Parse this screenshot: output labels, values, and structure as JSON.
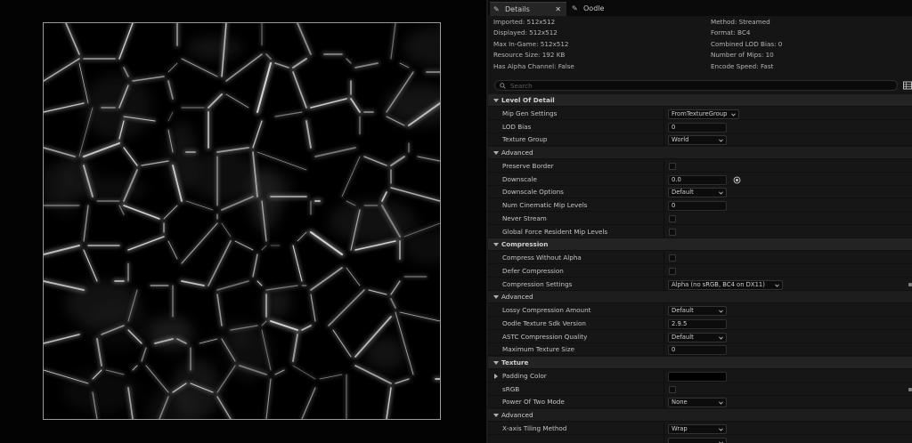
{
  "tabs": [
    {
      "label": "Details",
      "icon": "pencil-icon",
      "active": true
    },
    {
      "label": "Oodle",
      "icon": "pencil-icon",
      "active": false
    }
  ],
  "info": {
    "left": [
      "Imported: 512x512",
      "Displayed: 512x512",
      "Max In-Game: 512x512",
      "Resource Size: 192 KB",
      "Has Alpha Channel: False"
    ],
    "right": [
      "Method: Streamed",
      "Format: BC4",
      "Combined LOD Bias: 0",
      "Number of Mips: 10",
      "Encode Speed: Fast"
    ]
  },
  "search": {
    "placeholder": "Search"
  },
  "rows": [
    {
      "kind": "cat",
      "label": "Level Of Detail"
    },
    {
      "kind": "prop",
      "label": "Mip Gen Settings",
      "widget": "combo",
      "value": "FromTextureGroup"
    },
    {
      "kind": "prop",
      "label": "LOD Bias",
      "widget": "number",
      "value": "0"
    },
    {
      "kind": "prop",
      "label": "Texture Group",
      "widget": "combo",
      "value": "World"
    },
    {
      "kind": "sub",
      "label": "Advanced"
    },
    {
      "kind": "prop",
      "label": "Preserve Border",
      "widget": "check"
    },
    {
      "kind": "prop",
      "label": "Downscale",
      "widget": "number",
      "value": "0.0",
      "reset": true
    },
    {
      "kind": "prop",
      "label": "Downscale Options",
      "widget": "combo",
      "value": "Default"
    },
    {
      "kind": "prop",
      "label": "Num Cinematic Mip Levels",
      "widget": "number",
      "value": "0"
    },
    {
      "kind": "prop",
      "label": "Never Stream",
      "widget": "check"
    },
    {
      "kind": "prop",
      "label": "Global Force Resident Mip Levels",
      "widget": "check"
    },
    {
      "kind": "cat",
      "label": "Compression"
    },
    {
      "kind": "prop",
      "label": "Compress Without Alpha",
      "widget": "check"
    },
    {
      "kind": "prop",
      "label": "Defer Compression",
      "widget": "check"
    },
    {
      "kind": "prop",
      "label": "Compression Settings",
      "widget": "combo",
      "value": "Alpha (no sRGB, BC4 on DX11)",
      "edge": true
    },
    {
      "kind": "sub",
      "label": "Advanced"
    },
    {
      "kind": "prop",
      "label": "Lossy Compression Amount",
      "widget": "combo",
      "value": "Default"
    },
    {
      "kind": "prop",
      "label": "Oodle Texture Sdk Version",
      "widget": "number",
      "value": "2.9.5"
    },
    {
      "kind": "prop",
      "label": "ASTC Compression Quality",
      "widget": "combo",
      "value": "Default"
    },
    {
      "kind": "prop",
      "label": "Maximum Texture Size",
      "widget": "number",
      "value": "0"
    },
    {
      "kind": "cat",
      "label": "Texture"
    },
    {
      "kind": "prop",
      "label": "Padding Color",
      "widget": "color",
      "expandable": true
    },
    {
      "kind": "prop",
      "label": "sRGB",
      "widget": "check",
      "edge": true
    },
    {
      "kind": "prop",
      "label": "Power Of Two Mode",
      "widget": "combo",
      "value": "None"
    },
    {
      "kind": "sub",
      "label": "Advanced"
    },
    {
      "kind": "prop",
      "label": "X-axis Tiling Method",
      "widget": "combo",
      "value": "Wrap"
    },
    {
      "kind": "prop",
      "label": "",
      "widget": "combo",
      "value": ""
    }
  ],
  "colors": {
    "panel_bg": "#151515",
    "category_bg": "#232323",
    "viewport_bg": "#030303",
    "field_bg": "#0c0c0c"
  }
}
